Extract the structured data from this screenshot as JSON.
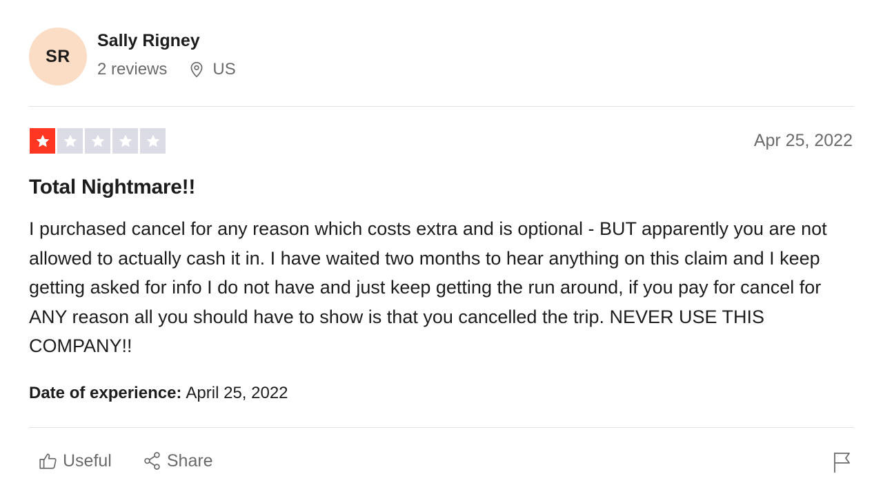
{
  "reviewer": {
    "initials": "SR",
    "name": "Sally Rigney",
    "reviews_count": "2 reviews",
    "location": "US",
    "avatar_color": "#fbdcc4"
  },
  "review": {
    "rating": 1,
    "rating_max": 5,
    "star_filled_color": "#ff3722",
    "star_empty_color": "#dcdce6",
    "date": "Apr 25, 2022",
    "title": "Total Nightmare!!",
    "body": "I purchased cancel for any reason which costs extra and is optional - BUT apparently you are not allowed to actually cash it in. I have waited two months to hear anything on this claim and I keep getting asked for info I do not have and just keep getting the run around, if you pay for cancel for ANY reason all you should have to show is that you cancelled the trip. NEVER USE THIS COMPANY!!",
    "experience_label": "Date of experience:",
    "experience_date": "April 25, 2022"
  },
  "actions": {
    "useful_label": "Useful",
    "share_label": "Share",
    "useful_icon": "thumbs-up-icon",
    "share_icon": "share-icon",
    "flag_icon": "flag-icon"
  }
}
